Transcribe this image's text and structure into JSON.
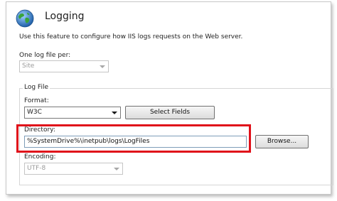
{
  "header": {
    "title": "Logging",
    "icon": "globe-icon"
  },
  "description": "Use this feature to configure how IIS logs requests on the Web server.",
  "one_log_file_per": {
    "label": "One log file per:",
    "value": "Site"
  },
  "log_file": {
    "legend": "Log File",
    "format": {
      "label": "Format:",
      "value": "W3C"
    },
    "select_fields_label": "Select Fields",
    "directory": {
      "label": "Directory:",
      "value": "%SystemDrive%\\inetpub\\logs\\LogFiles"
    },
    "browse_label": "Browse...",
    "encoding": {
      "label": "Encoding:",
      "value": "UTF-8"
    }
  },
  "colors": {
    "highlight": "#e0101a",
    "globe_blue": "#2a78c8",
    "globe_green": "#3aa33a"
  }
}
